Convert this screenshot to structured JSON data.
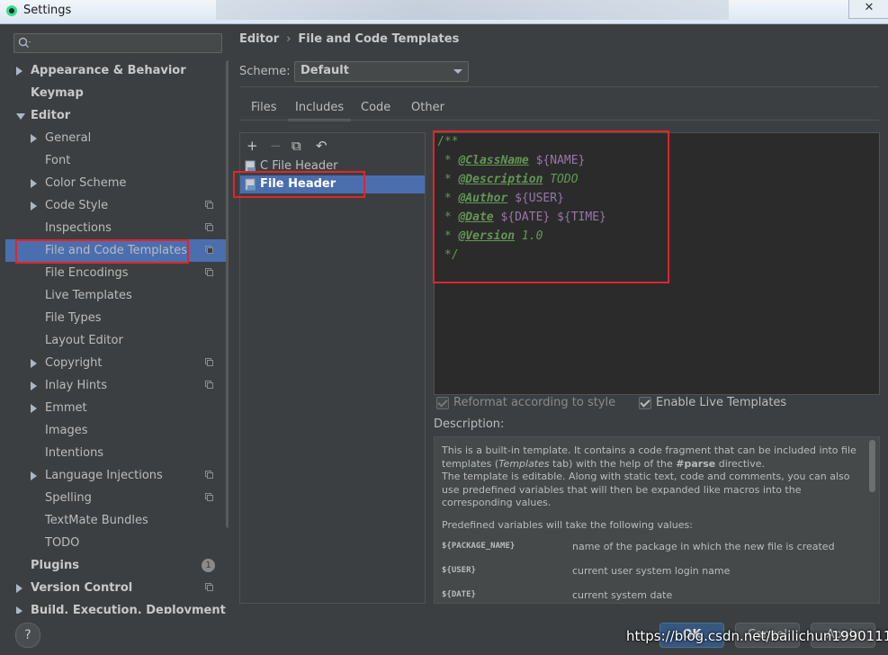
{
  "window": {
    "title": "Settings",
    "close": "✕"
  },
  "search": {
    "placeholder": ""
  },
  "tree": [
    {
      "label": "Appearance & Behavior",
      "level": 0,
      "arrow": "right",
      "bold": true
    },
    {
      "label": "Keymap",
      "level": 0,
      "bold": true
    },
    {
      "label": "Editor",
      "level": 0,
      "arrow": "down",
      "bold": true
    },
    {
      "label": "General",
      "level": 1,
      "arrow": "right"
    },
    {
      "label": "Font",
      "level": 1
    },
    {
      "label": "Color Scheme",
      "level": 1,
      "arrow": "right"
    },
    {
      "label": "Code Style",
      "level": 1,
      "arrow": "right",
      "proj": true
    },
    {
      "label": "Inspections",
      "level": 1,
      "proj": true
    },
    {
      "label": "File and Code Templates",
      "level": 1,
      "proj": true,
      "selected": true
    },
    {
      "label": "File Encodings",
      "level": 1,
      "proj": true
    },
    {
      "label": "Live Templates",
      "level": 1
    },
    {
      "label": "File Types",
      "level": 1
    },
    {
      "label": "Layout Editor",
      "level": 1
    },
    {
      "label": "Copyright",
      "level": 1,
      "arrow": "right",
      "proj": true
    },
    {
      "label": "Inlay Hints",
      "level": 1,
      "arrow": "right",
      "proj": true
    },
    {
      "label": "Emmet",
      "level": 1,
      "arrow": "right"
    },
    {
      "label": "Images",
      "level": 1
    },
    {
      "label": "Intentions",
      "level": 1
    },
    {
      "label": "Language Injections",
      "level": 1,
      "arrow": "right",
      "proj": true
    },
    {
      "label": "Spelling",
      "level": 1,
      "proj": true
    },
    {
      "label": "TextMate Bundles",
      "level": 1
    },
    {
      "label": "TODO",
      "level": 1
    },
    {
      "label": "Plugins",
      "level": 0,
      "bold": true,
      "badge": "1"
    },
    {
      "label": "Version Control",
      "level": 0,
      "arrow": "right",
      "bold": true,
      "proj": true
    },
    {
      "label": "Build, Execution, Deployment",
      "level": 0,
      "arrow": "right",
      "bold": true
    }
  ],
  "breadcrumb": {
    "parent": "Editor",
    "sep": "›",
    "current": "File and Code Templates"
  },
  "scheme": {
    "label": "Scheme:",
    "value": "Default"
  },
  "tabs": [
    "Files",
    "Includes",
    "Code",
    "Other"
  ],
  "active_tab": "Includes",
  "toolbar": {
    "add": "+",
    "remove": "−",
    "copy": "⧉",
    "reset": "↶"
  },
  "templates": [
    "C File Header",
    "File Header"
  ],
  "selected_template": "File Header",
  "editor": {
    "lines": [
      [
        {
          "t": "/**",
          "c": "c-gray"
        }
      ],
      [
        {
          "t": " * ",
          "c": "c-gray"
        },
        {
          "t": "@ClassName",
          "c": "c-tag"
        },
        {
          "t": " ${NAME}",
          "c": "c-var"
        }
      ],
      [
        {
          "t": " * ",
          "c": "c-gray"
        },
        {
          "t": "@Description",
          "c": "c-tag"
        },
        {
          "t": " TODO",
          "c": "c-it"
        }
      ],
      [
        {
          "t": " * ",
          "c": "c-gray"
        },
        {
          "t": "@Author",
          "c": "c-tag"
        },
        {
          "t": " ${USER}",
          "c": "c-var"
        }
      ],
      [
        {
          "t": " * ",
          "c": "c-gray"
        },
        {
          "t": "@Date",
          "c": "c-tag"
        },
        {
          "t": " ${DATE} ${TIME}",
          "c": "c-var"
        }
      ],
      [
        {
          "t": " * ",
          "c": "c-gray"
        },
        {
          "t": "@Version",
          "c": "c-tag"
        },
        {
          "t": " 1.0",
          "c": "c-it"
        }
      ],
      [
        {
          "t": " */",
          "c": "c-gray"
        }
      ]
    ]
  },
  "options": {
    "reformat": "Reformat according to style",
    "live": "Enable Live Templates"
  },
  "description": {
    "label": "Description:",
    "p1a": "This is a built-in template. It contains a code fragment that can be included into file templates (",
    "p1b": "Templates",
    "p1c": " tab) with the help of the ",
    "p1d": "#parse",
    "p1e": " directive.",
    "p2": "The template is editable. Along with static text, code and comments, you can also use predefined variables that will then be expanded like macros into the corresponding values.",
    "p3": "Predefined variables will take the following values:",
    "vars": [
      {
        "name": "${PACKAGE_NAME}",
        "desc": "name of the package in which the new file is created"
      },
      {
        "name": "${USER}",
        "desc": "current user system login name"
      },
      {
        "name": "${DATE}",
        "desc": "current system date"
      }
    ]
  },
  "buttons": {
    "help": "?",
    "ok": "OK",
    "cancel": "Cancel",
    "apply": "Apply"
  },
  "watermark": "https://blog.csdn.net/bailichun19901111",
  "colors": {
    "selection": "#4b6eaf",
    "highlight": "#e0252a",
    "background": "#3c3f41",
    "editor_bg": "#2b2b2b"
  }
}
